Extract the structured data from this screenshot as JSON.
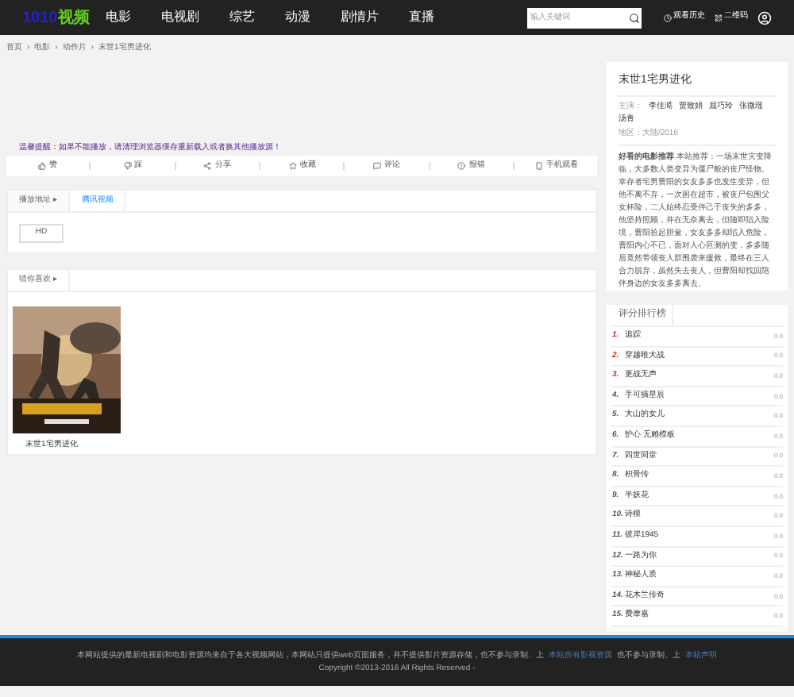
{
  "header": {
    "logo": [
      {
        "text": "1010",
        "color": "#2222cc"
      },
      {
        "text": "视频",
        "color": "#66cc22"
      }
    ],
    "nav": [
      {
        "label": "电影"
      },
      {
        "label": "电视剧"
      },
      {
        "label": "综艺"
      },
      {
        "label": "动漫"
      },
      {
        "label": "剧情片"
      },
      {
        "label": "直播"
      }
    ],
    "search": {
      "placeholder": "输入关键词"
    },
    "links": [
      {
        "label": "观看历史"
      },
      {
        "label": "二维码"
      }
    ]
  },
  "breadcrumb": [
    {
      "label": "首页"
    },
    {
      "separator": "›",
      "label": "电影"
    },
    {
      "separator": "›",
      "label": "动作片"
    },
    {
      "separator": "›",
      "label": "末世1宅男进化"
    }
  ],
  "notice": "温馨提醒：如果不能播放，请清理浏览器缓存重新载入或者换其他播放源！",
  "actions": [
    {
      "label": "赞",
      "kind": "like"
    },
    {
      "label": "踩",
      "kind": "dislike"
    },
    {
      "label": "分享",
      "kind": "share"
    },
    {
      "label": "收藏",
      "kind": "star"
    },
    {
      "label": "评论",
      "kind": "comment"
    },
    {
      "label": "报错",
      "kind": "alert"
    },
    {
      "label": "手机观看",
      "kind": "phone"
    }
  ],
  "sources": {
    "tabs": [
      {
        "label": "播放地址 ▸",
        "selected": false
      },
      {
        "label": "腾讯视频",
        "selected": true
      }
    ],
    "episodes": [
      "HD"
    ]
  },
  "related": {
    "title": "猜你喜欢 ▸",
    "items": [
      {
        "caption": "末世1宅男进化"
      }
    ]
  },
  "info": {
    "title": "末世1宅男进化",
    "cast_label": "主演：",
    "cast": [
      "李佳澔",
      "贾致娟",
      "屈巧玲",
      "张微瑶",
      "汤青"
    ],
    "meta": "地区：大陆/2016",
    "description": "**好看的电影推荐** 本站推荐：一场末世灾变降临，大多数人类变异为僵尸般的丧尸怪物。幸存者宅男曹阳的女友多多也发生变异，但他不离不弃，一次困在超市，被丧尸包围父女杯险，二人始终忍受伴己于丧失的多多，他坚持照顾，并在无奈离去，但随即陷入险境，曹阳拾起胆量，女友多多却陷入危险，曹阳内心不已，面对人心叵测的变，多多随后竟然带领丧人群围袭来援救，最终在三人合力脱弃，虽然失去丧人，但曹阳却找回陪伴身边的女友多多离去。"
  },
  "ranking": {
    "title": "评分排行榜",
    "items": [
      {
        "rank": "1.",
        "title": "追踪",
        "score": "0.0",
        "top": true
      },
      {
        "rank": "2.",
        "title": "穿越唯大战",
        "score": "0.0",
        "top": true
      },
      {
        "rank": "3.",
        "title": "更战无声",
        "score": "0.0",
        "top": true
      },
      {
        "rank": "4.",
        "title": "手可摘星辰",
        "score": "0.0",
        "top": false
      },
      {
        "rank": "5.",
        "title": "大山的女儿",
        "score": "0.0",
        "top": false
      },
      {
        "rank": "6.",
        "title": "护心 无赖模板",
        "score": "0.0",
        "top": false
      },
      {
        "rank": "7.",
        "title": "四世同堂",
        "score": "0.0",
        "top": false
      },
      {
        "rank": "8.",
        "title": "枳骨传",
        "score": "0.0",
        "top": false
      },
      {
        "rank": "9.",
        "title": "半妖花",
        "score": "0.0",
        "top": false
      },
      {
        "rank": "10.",
        "title": "诗檀",
        "score": "0.0",
        "top": false
      },
      {
        "rank": "11.",
        "title": "彼岸1945",
        "score": "0.0",
        "top": false
      },
      {
        "rank": "12.",
        "title": "一路为你",
        "score": "0.0",
        "top": false
      },
      {
        "rank": "13.",
        "title": "神秘人质",
        "score": "0.0",
        "top": false
      },
      {
        "rank": "14.",
        "title": "花木兰传奇",
        "score": "0.0",
        "top": false
      },
      {
        "rank": "15.",
        "title": "费摩嘉",
        "score": "0.0",
        "top": false
      }
    ]
  },
  "footer": {
    "text": "本网站提供的最新电视剧和电影资源均来自于各大视频网站，本网站只提供web页面服务，并不提供影片资源存储，也不参与录制、上",
    "link1": "本站所有影视资源",
    "text2": "也不参与录制、上",
    "link2": "本站声明",
    "copyright": "Copyright ©2013-2016 All Rights Reserved -"
  }
}
